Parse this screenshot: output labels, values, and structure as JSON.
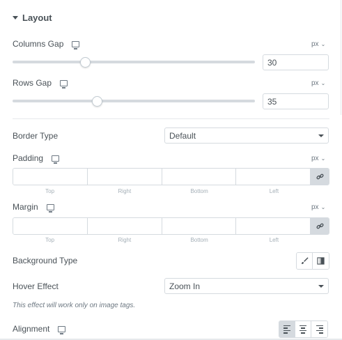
{
  "section": {
    "title": "Layout"
  },
  "columns_gap": {
    "label": "Columns Gap",
    "unit": "px",
    "value": "30",
    "slider_fraction": 0.3
  },
  "rows_gap": {
    "label": "Rows Gap",
    "unit": "px",
    "value": "35",
    "slider_fraction": 0.35
  },
  "border_type": {
    "label": "Border Type",
    "selected": "Default"
  },
  "padding": {
    "label": "Padding",
    "unit": "px",
    "sides": {
      "top": "Top",
      "right": "Right",
      "bottom": "Bottom",
      "left": "Left"
    }
  },
  "margin": {
    "label": "Margin",
    "unit": "px",
    "sides": {
      "top": "Top",
      "right": "Right",
      "bottom": "Bottom",
      "left": "Left"
    }
  },
  "background_type": {
    "label": "Background Type",
    "options": [
      "brush-icon",
      "gradient-icon"
    ]
  },
  "hover_effect": {
    "label": "Hover Effect",
    "selected": "Zoom In",
    "note": "This effect will work only on image tags."
  },
  "alignment": {
    "label": "Alignment",
    "options": [
      "align-left-icon",
      "align-center-icon",
      "align-right-icon"
    ],
    "active": "align-left-icon"
  },
  "colors": {
    "text": "#495157",
    "border": "#d5dadf",
    "muted": "#a4afb7",
    "active_bg": "#d5dadf"
  }
}
